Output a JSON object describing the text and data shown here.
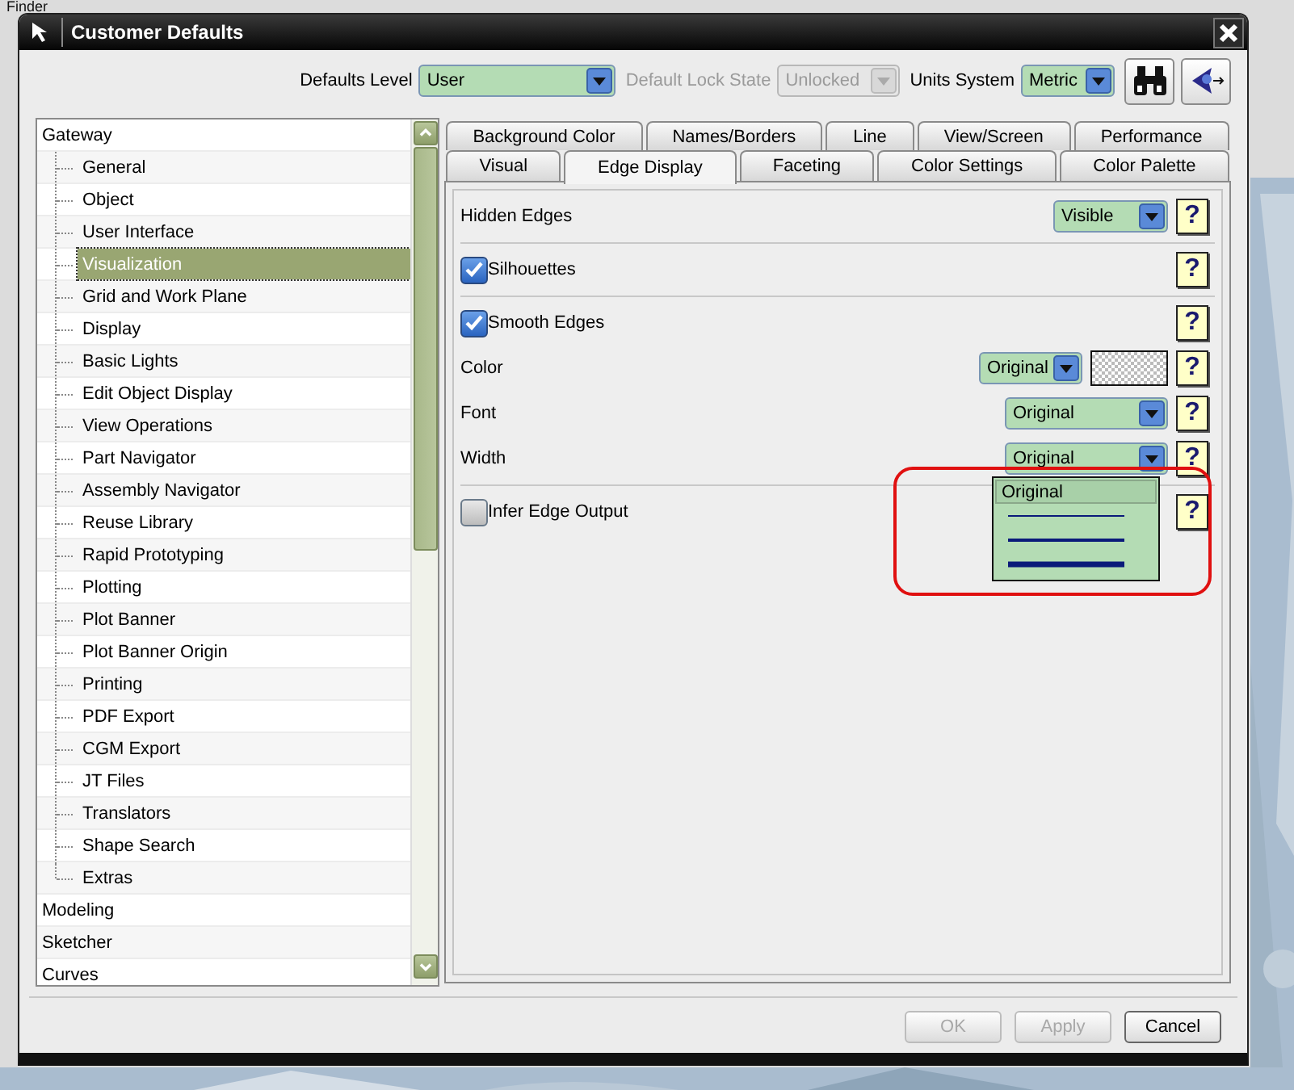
{
  "background_app": {
    "title": "Finder"
  },
  "window": {
    "title": "Customer Defaults"
  },
  "header": {
    "fields": [
      {
        "label": "Defaults Level",
        "value": "User",
        "disabled": false
      },
      {
        "label": "Default Lock State",
        "value": "Unlocked",
        "disabled": true
      },
      {
        "label": "Units System",
        "value": "Metric",
        "disabled": false
      }
    ]
  },
  "tree": {
    "items": [
      {
        "label": "Gateway",
        "selected": false,
        "children": [
          {
            "label": "General",
            "selected": false
          },
          {
            "label": "Object",
            "selected": false
          },
          {
            "label": "User Interface",
            "selected": false
          },
          {
            "label": "Visualization",
            "selected": true
          },
          {
            "label": "Grid and Work Plane",
            "selected": false
          },
          {
            "label": "Display",
            "selected": false
          },
          {
            "label": "Basic Lights",
            "selected": false
          },
          {
            "label": "Edit Object Display",
            "selected": false
          },
          {
            "label": "View Operations",
            "selected": false
          },
          {
            "label": "Part Navigator",
            "selected": false
          },
          {
            "label": "Assembly Navigator",
            "selected": false
          },
          {
            "label": "Reuse Library",
            "selected": false
          },
          {
            "label": "Rapid Prototyping",
            "selected": false
          },
          {
            "label": "Plotting",
            "selected": false
          },
          {
            "label": "Plot Banner",
            "selected": false
          },
          {
            "label": "Plot Banner Origin",
            "selected": false
          },
          {
            "label": "Printing",
            "selected": false
          },
          {
            "label": "PDF Export",
            "selected": false
          },
          {
            "label": "CGM Export",
            "selected": false
          },
          {
            "label": "JT Files",
            "selected": false
          },
          {
            "label": "Translators",
            "selected": false
          },
          {
            "label": "Shape Search",
            "selected": false
          },
          {
            "label": "Extras",
            "selected": false
          }
        ]
      },
      {
        "label": "Modeling",
        "selected": false
      },
      {
        "label": "Sketcher",
        "selected": false
      },
      {
        "label": "Curves",
        "selected": false
      }
    ]
  },
  "tab_rows": [
    {
      "tabs": [
        {
          "label": "Background Color",
          "selected": false
        },
        {
          "label": "Names/Borders",
          "selected": false
        },
        {
          "label": "Line",
          "selected": false
        },
        {
          "label": "View/Screen",
          "selected": false
        },
        {
          "label": "Performance",
          "selected": false
        }
      ]
    },
    {
      "tabs": [
        {
          "label": "Visual",
          "selected": false
        },
        {
          "label": "Edge Display",
          "selected": true
        },
        {
          "label": "Faceting",
          "selected": false
        },
        {
          "label": "Color Settings",
          "selected": false
        },
        {
          "label": "Color Palette",
          "selected": false
        }
      ]
    }
  ],
  "panel": {
    "groups": [
      {
        "items": [
          {
            "kind": "combo",
            "label": "Hidden Edges",
            "value": "Visible",
            "help": "?"
          }
        ]
      },
      {
        "items": [
          {
            "kind": "checkbox",
            "label": "Silhouettes",
            "checked": true,
            "help": "?"
          }
        ]
      },
      {
        "items": [
          {
            "kind": "checkbox",
            "label": "Smooth Edges",
            "checked": true,
            "help": "?"
          },
          {
            "kind": "color",
            "label": "Color",
            "value": "Original",
            "help": "?"
          },
          {
            "kind": "combo",
            "label": "Font",
            "value": "Original",
            "help": "?"
          },
          {
            "kind": "combo",
            "label": "Width",
            "value": "Original",
            "help": "?",
            "open": true,
            "options": [
              {
                "kind": "text",
                "label": "Original",
                "selected": true
              },
              {
                "kind": "thin",
                "selected": false
              },
              {
                "kind": "medium",
                "selected": false
              },
              {
                "kind": "thick",
                "selected": false
              }
            ]
          }
        ]
      },
      {
        "items": [
          {
            "kind": "checkbox",
            "label": "Infer Edge Output",
            "checked": false,
            "help": "?"
          }
        ]
      }
    ]
  },
  "buttons": [
    {
      "label": "OK",
      "disabled": true
    },
    {
      "label": "Apply",
      "disabled": true
    },
    {
      "label": "Cancel",
      "disabled": false
    }
  ]
}
